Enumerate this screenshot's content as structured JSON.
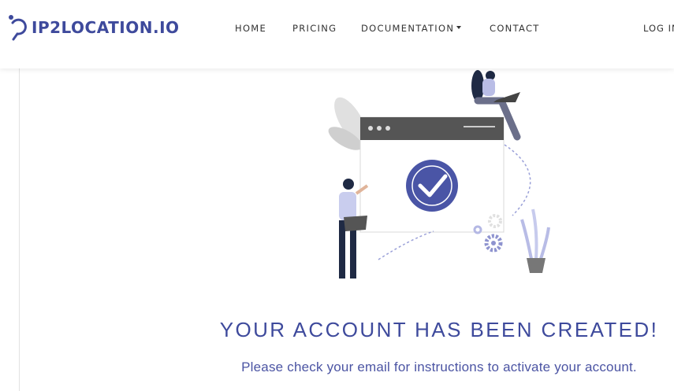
{
  "brand": {
    "name": "IP2LOCATION.IO",
    "color": "#3e4a9c"
  },
  "nav": {
    "items": [
      {
        "label": "HOME"
      },
      {
        "label": "PRICING"
      },
      {
        "label": "DOCUMENTATION",
        "has_dropdown": true
      },
      {
        "label": "CONTACT"
      }
    ],
    "login_label": "LOG IN"
  },
  "illustration": {
    "icon": "checkmark-circle-icon",
    "accent_color": "#4a55a6"
  },
  "message": {
    "title": "YOUR ACCOUNT HAS BEEN CREATED!",
    "subtitle": "Please check your email for instructions to activate your account."
  }
}
